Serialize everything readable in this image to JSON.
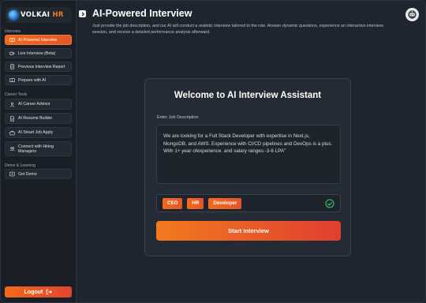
{
  "brand": {
    "name_main": "VOLKAI",
    "name_accent": "HR"
  },
  "sidebar": {
    "sections": [
      {
        "label": "Interview"
      },
      {
        "label": "Career Tools"
      },
      {
        "label": "Demo & Learning"
      }
    ],
    "items": [
      {
        "label": "AI-Powered Interview",
        "icon": "interview-icon",
        "active": true
      },
      {
        "label": "Live Interview (Beta)",
        "icon": "video-icon"
      },
      {
        "label": "Previous Interview Report",
        "icon": "report-icon"
      },
      {
        "label": "Prepare with AI",
        "icon": "book-icon"
      },
      {
        "label": "AI Career Advisor",
        "icon": "user-advisor-icon"
      },
      {
        "label": "AI Resume Builder",
        "icon": "document-icon"
      },
      {
        "label": "AI Smart Job Apply",
        "icon": "briefcase-icon"
      },
      {
        "label": "Connect with Hiring Managers",
        "icon": "people-icon"
      },
      {
        "label": "Get Demo",
        "icon": "play-icon"
      }
    ],
    "logout_label": "Logout"
  },
  "header": {
    "title": "AI-Powered Interview",
    "description": "Just provide the job description, and our AI will conduct a realistic interview tailored to the role. Answer dynamic questions, experience an interactive interview session, and receive a detailed performance analysis afterward."
  },
  "card": {
    "title": "Welcome to AI Interview Assistant",
    "field_label": "Enter Job Description",
    "job_description": "We are looking for a Full Stack Developer with expertise in Next.js, MongoDB, and AWS. Experience with CI/CD pipelines and DevOps is a plus. With 1+ year ofexperience. and salary ranges:-3-6 LPA\"",
    "tags": [
      "CEO",
      "HR",
      "Developer"
    ],
    "start_label": "Start Interview"
  },
  "colors": {
    "accent": "#f26a1b",
    "accent_end": "#e0452f",
    "success": "#3cc46b"
  }
}
